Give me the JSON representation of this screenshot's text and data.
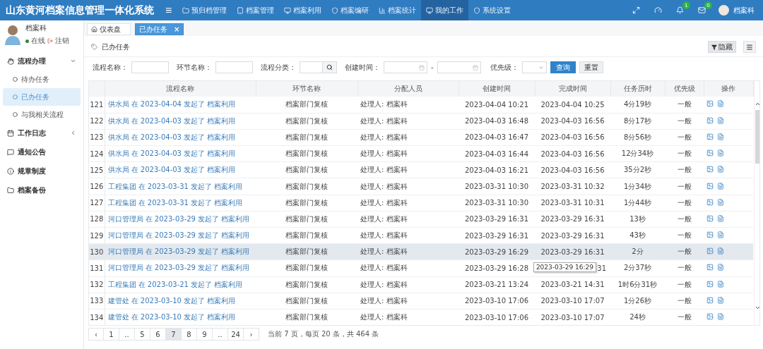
{
  "app_title": "山东黄河档案信息管理一体化系统",
  "menu_toggle": "≡",
  "nav": [
    {
      "label": "预归档管理",
      "selected": false
    },
    {
      "label": "档案管理",
      "selected": false
    },
    {
      "label": "档案利用",
      "selected": false
    },
    {
      "label": "档案编研",
      "selected": false
    },
    {
      "label": "档案统计",
      "selected": false
    },
    {
      "label": "我的工作",
      "selected": true
    },
    {
      "label": "系统设置",
      "selected": false
    }
  ],
  "notifications": [
    {
      "badge": "1"
    },
    {
      "badge": "0"
    }
  ],
  "header_user": "档案科",
  "user": {
    "name": "档案科",
    "status": "在线",
    "logout": "注销"
  },
  "sidebar": [
    {
      "label": "流程办理",
      "expanded": true,
      "children": [
        {
          "label": "待办任务",
          "selected": false
        },
        {
          "label": "已办任务",
          "selected": true
        },
        {
          "label": "与我相关流程",
          "selected": false
        }
      ]
    },
    {
      "label": "工作日志",
      "expanded": false
    },
    {
      "label": "通知公告"
    },
    {
      "label": "规章制度"
    },
    {
      "label": "档案备份"
    }
  ],
  "tabs": [
    {
      "label": "仪表盘",
      "selected": false
    },
    {
      "label": "已办任务",
      "selected": true,
      "close": "×"
    }
  ],
  "page_title": "已办任务",
  "toolbar": {
    "hide": "隐藏"
  },
  "filters": {
    "process_name": "流程名称：",
    "step_name": "环节名称：",
    "category": "流程分类：",
    "created": "创建时间：",
    "range_sep": "-",
    "priority": "优先级：",
    "query": "查询",
    "reset": "重置"
  },
  "table": {
    "columns": [
      "流程名称",
      "环节名称",
      "分配人员",
      "创建时间",
      "完成时间",
      "任务历时",
      "优先级",
      "操作"
    ],
    "rows": [
      {
        "index": "121",
        "process": "供水局 在 2023-04-04 发起了 档案利用",
        "step": "档案部门复核",
        "assignee": "处理人: 档案科",
        "created": "2023-04-04 10:21",
        "completed": "2023-04-04 10:25",
        "duration": "4分19秒",
        "priority": "一般",
        "hover": false
      },
      {
        "index": "122",
        "process": "供水局 在 2023-04-03 发起了 档案利用",
        "step": "档案部门复核",
        "assignee": "处理人: 档案科",
        "created": "2023-04-03 16:48",
        "completed": "2023-04-03 16:56",
        "duration": "8分17秒",
        "priority": "一般",
        "hover": false
      },
      {
        "index": "123",
        "process": "供水局 在 2023-04-03 发起了 档案利用",
        "step": "档案部门复核",
        "assignee": "处理人: 档案科",
        "created": "2023-04-03 16:47",
        "completed": "2023-04-03 16:56",
        "duration": "8分56秒",
        "priority": "一般",
        "hover": false
      },
      {
        "index": "124",
        "process": "供水局 在 2023-04-03 发起了 档案利用",
        "step": "档案部门复核",
        "assignee": "处理人: 档案科",
        "created": "2023-04-03 16:44",
        "completed": "2023-04-03 16:56",
        "duration": "12分34秒",
        "priority": "一般",
        "hover": false
      },
      {
        "index": "125",
        "process": "供水局 在 2023-04-03 发起了 档案利用",
        "step": "档案部门复核",
        "assignee": "处理人: 档案科",
        "created": "2023-04-03 16:21",
        "completed": "2023-04-03 16:56",
        "duration": "35分2秒",
        "priority": "一般",
        "hover": false
      },
      {
        "index": "126",
        "process": "工程集团 在 2023-03-31 发起了 档案利用",
        "step": "档案部门复核",
        "assignee": "处理人: 档案科",
        "created": "2023-03-31 10:30",
        "completed": "2023-03-31 10:32",
        "duration": "1分34秒",
        "priority": "一般",
        "hover": false
      },
      {
        "index": "127",
        "process": "工程集团 在 2023-03-31 发起了 档案利用",
        "step": "档案部门复核",
        "assignee": "处理人: 档案科",
        "created": "2023-03-31 10:30",
        "completed": "2023-03-31 10:31",
        "duration": "1分44秒",
        "priority": "一般",
        "hover": false
      },
      {
        "index": "128",
        "process": "河口管理局 在 2023-03-29 发起了 档案利用",
        "step": "档案部门复核",
        "assignee": "处理人: 档案科",
        "created": "2023-03-29 16:31",
        "completed": "2023-03-29 16:31",
        "duration": "13秒",
        "priority": "一般",
        "hover": false
      },
      {
        "index": "129",
        "process": "河口管理局 在 2023-03-29 发起了 档案利用",
        "step": "档案部门复核",
        "assignee": "处理人: 档案科",
        "created": "2023-03-29 16:31",
        "completed": "2023-03-29 16:31",
        "duration": "43秒",
        "priority": "一般",
        "hover": false
      },
      {
        "index": "130",
        "process": "河口管理局 在 2023-03-29 发起了 档案利用",
        "step": "档案部门复核",
        "assignee": "处理人: 档案科",
        "created": "2023-03-29 16:29",
        "completed": "2023-03-29 16:31",
        "duration": "2分",
        "priority": "一般",
        "hover": true
      },
      {
        "index": "131",
        "process": "河口管理局 在 2023-03-29 发起了 档案利用",
        "step": "档案部门复核",
        "assignee": "处理人: 档案科",
        "created": "2023-03-29 16:28",
        "completed": "31",
        "duration": "2分37秒",
        "priority": "一般",
        "hover": false,
        "tooltip": "2023-03-29 16:29"
      },
      {
        "index": "132",
        "process": "工程集团 在 2023-03-21 发起了 档案利用",
        "step": "档案部门复核",
        "assignee": "处理人: 档案科",
        "created": "2023-03-21 13:24",
        "completed": "2023-03-21 14:31",
        "duration": "1时6分31秒",
        "priority": "一般",
        "hover": false
      },
      {
        "index": "133",
        "process": "建管处 在 2023-03-10 发起了 档案利用",
        "step": "档案部门复核",
        "assignee": "处理人: 档案科",
        "created": "2023-03-10 17:06",
        "completed": "2023-03-10 17:07",
        "duration": "1分26秒",
        "priority": "一般",
        "hover": false
      },
      {
        "index": "134",
        "process": "建管处 在 2023-03-10 发起了 档案利用",
        "step": "档案部门复核",
        "assignee": "处理人: 档案科",
        "created": "2023-03-10 17:06",
        "completed": "2023-03-10 17:07",
        "duration": "24秒",
        "priority": "一般",
        "hover": false
      }
    ]
  },
  "pagination": {
    "prev": "‹",
    "next": "›",
    "pages": [
      {
        "label": "1",
        "selected": false
      },
      {
        "label": "..",
        "selected": false
      },
      {
        "label": "5",
        "selected": false
      },
      {
        "label": "6",
        "selected": false
      },
      {
        "label": "7",
        "selected": true
      },
      {
        "label": "8",
        "selected": false
      },
      {
        "label": "9",
        "selected": false
      },
      {
        "label": "..",
        "selected": false
      },
      {
        "label": "24",
        "selected": false
      }
    ],
    "summary": "当前 7 页，每页 20 条，共 464 条"
  }
}
